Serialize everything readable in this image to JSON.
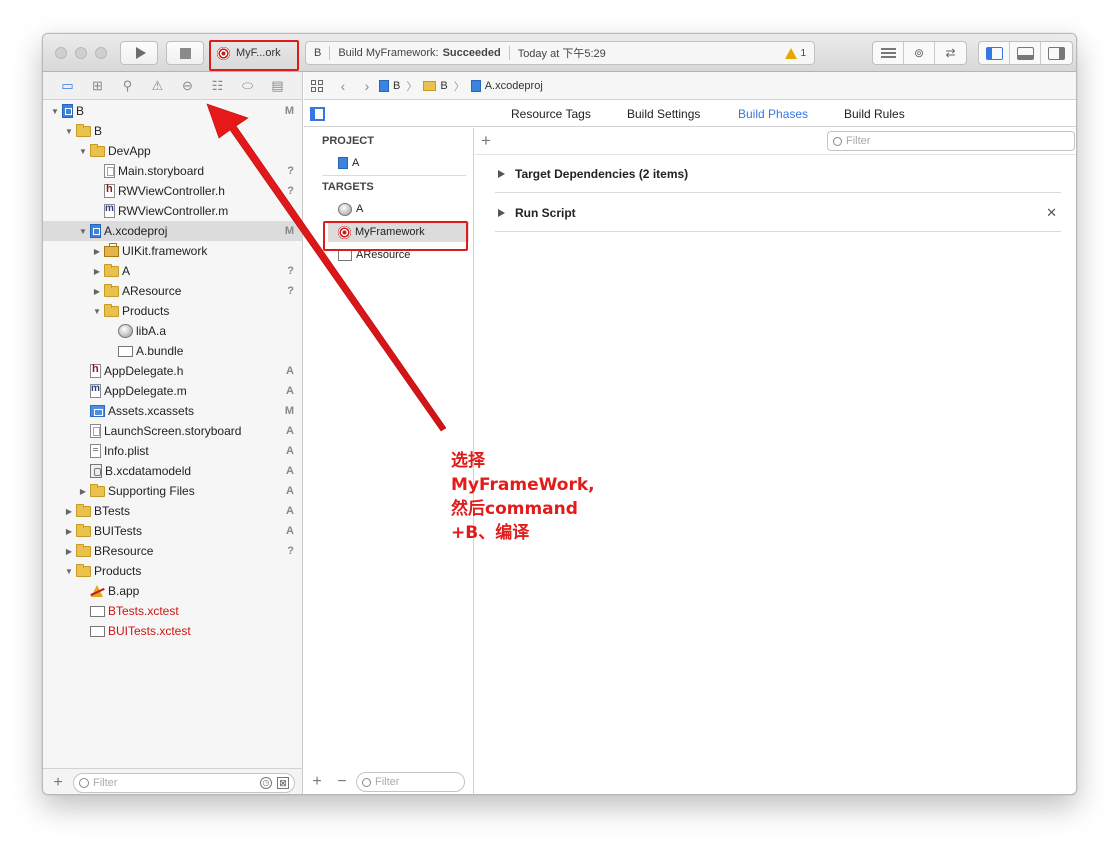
{
  "toolbar": {
    "scheme": "MyF...ork",
    "activity": {
      "destination": "B",
      "status_prefix": "Build MyFramework:",
      "status_result": "Succeeded",
      "time": "Today at 下午5:29",
      "warning_count": "1"
    }
  },
  "navigator": {
    "rows": [
      {
        "label": "B",
        "badge": "M"
      },
      {
        "label": "B",
        "badge": ""
      },
      {
        "label": "DevApp",
        "badge": ""
      },
      {
        "label": "Main.storyboard",
        "badge": "?"
      },
      {
        "label": "RWViewController.h",
        "badge": "?"
      },
      {
        "label": "RWViewController.m",
        "badge": ""
      },
      {
        "label": "A.xcodeproj",
        "badge": "M"
      },
      {
        "label": "UIKit.framework",
        "badge": ""
      },
      {
        "label": "A",
        "badge": "?"
      },
      {
        "label": "AResource",
        "badge": "?"
      },
      {
        "label": "Products",
        "badge": ""
      },
      {
        "label": "libA.a",
        "badge": ""
      },
      {
        "label": "A.bundle",
        "badge": ""
      },
      {
        "label": "AppDelegate.h",
        "badge": "A"
      },
      {
        "label": "AppDelegate.m",
        "badge": "A"
      },
      {
        "label": "Assets.xcassets",
        "badge": "M"
      },
      {
        "label": "LaunchScreen.storyboard",
        "badge": "A"
      },
      {
        "label": "Info.plist",
        "badge": "A"
      },
      {
        "label": "B.xcdatamodeld",
        "badge": "A"
      },
      {
        "label": "Supporting Files",
        "badge": "A"
      },
      {
        "label": "BTests",
        "badge": "A"
      },
      {
        "label": "BUITests",
        "badge": "A"
      },
      {
        "label": "BResource",
        "badge": "?"
      },
      {
        "label": "Products",
        "badge": ""
      },
      {
        "label": "B.app",
        "badge": ""
      },
      {
        "label": "BTests.xctest",
        "badge": ""
      },
      {
        "label": "BUITests.xctest",
        "badge": ""
      }
    ],
    "filter_placeholder": "Filter"
  },
  "jumpbar": {
    "crumbs": [
      "B",
      "B",
      "A.xcodeproj"
    ]
  },
  "editor_tabs": [
    "Resource Tags",
    "Build Settings",
    "Build Phases",
    "Build Rules"
  ],
  "targets_list": {
    "project_header": "PROJECT",
    "project_item": "A",
    "targets_header": "TARGETS",
    "targets": [
      "A",
      "MyFramework",
      "AResource"
    ],
    "filter_placeholder": "Filter"
  },
  "phases": {
    "filter_placeholder": "Filter",
    "items": [
      "Target Dependencies (2 items)",
      "Run Script"
    ]
  },
  "annotation": {
    "lines": [
      "选择",
      "MyFrameWork,",
      "然后command",
      "+B、编译"
    ],
    "color": "#e21b1b"
  }
}
